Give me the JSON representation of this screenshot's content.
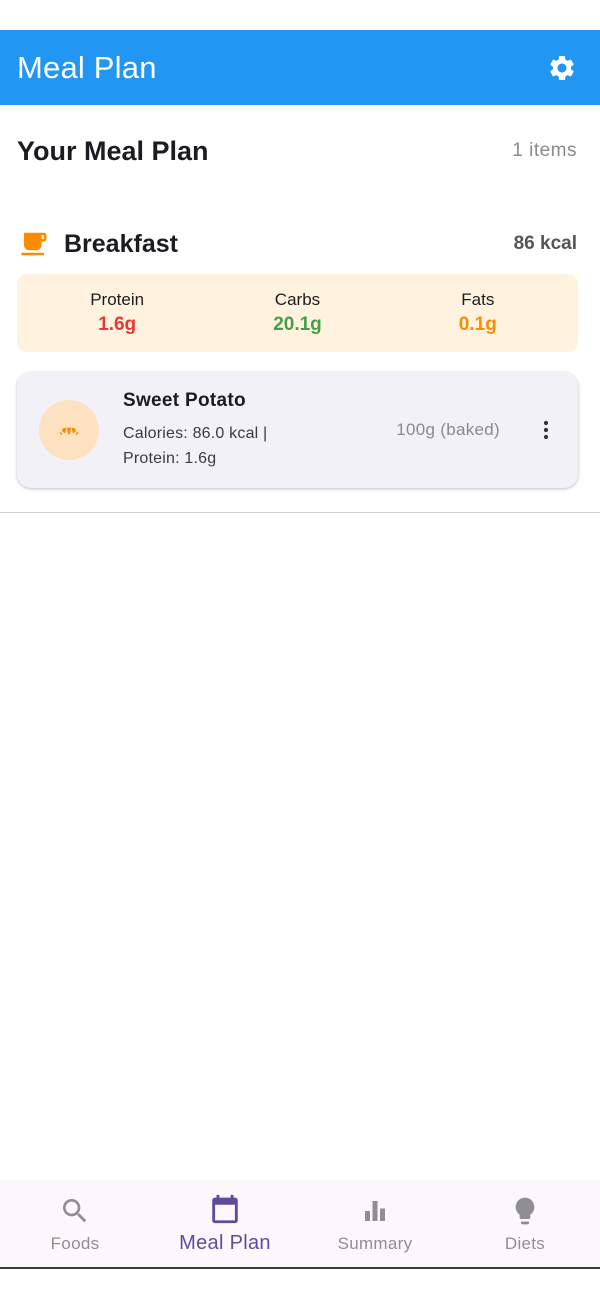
{
  "app_bar": {
    "title": "Meal Plan",
    "background": "#2196f3",
    "settings_icon": "gear-icon"
  },
  "page": {
    "title": "Your Meal Plan",
    "items_count": "1 items"
  },
  "meal": {
    "name": "Breakfast",
    "icon": "coffee-cup-icon",
    "icon_color": "#fb8c00",
    "kcal": "86 kcal",
    "macros": {
      "protein": {
        "label": "Protein",
        "value": "1.6g",
        "color": "#e53935"
      },
      "carbs": {
        "label": "Carbs",
        "value": "20.1g",
        "color": "#43a047"
      },
      "fats": {
        "label": "Fats",
        "value": "0.1g",
        "color": "#fb8c00"
      }
    }
  },
  "food_items": [
    {
      "name": "Sweet Potato",
      "icon": "croissant-icon",
      "details": "Calories: 86.0 kcal | Protein: 1.6g",
      "portion": "100g (baked)",
      "menu_icon": "more-vertical-icon"
    }
  ],
  "bottom_nav": {
    "items": [
      {
        "label": "Foods",
        "icon": "search-icon",
        "active": false
      },
      {
        "label": "Meal Plan",
        "icon": "calendar-icon",
        "active": true
      },
      {
        "label": "Summary",
        "icon": "bar-chart-icon",
        "active": false
      },
      {
        "label": "Diets",
        "icon": "lightbulb-icon",
        "active": false
      }
    ],
    "active_color": "#5e4b9c",
    "inactive_color": "#8e8e93"
  }
}
